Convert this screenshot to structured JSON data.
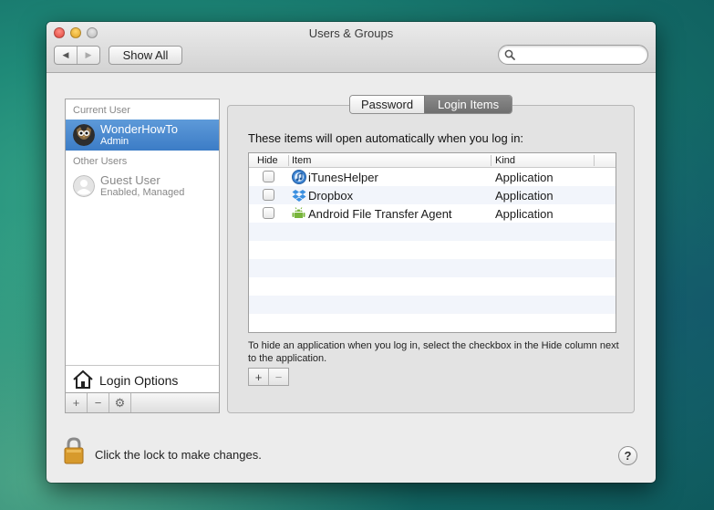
{
  "window": {
    "title": "Users & Groups"
  },
  "toolbar": {
    "back_glyph": "◀",
    "forward_glyph": "▶",
    "show_all_label": "Show All",
    "search_value": ""
  },
  "sidebar": {
    "current_user_heading": "Current User",
    "current_user": {
      "name": "WonderHowTo",
      "role": "Admin",
      "icon": "owl-avatar-icon"
    },
    "other_users_heading": "Other Users",
    "other_users": [
      {
        "name": "Guest User",
        "role": "Enabled, Managed",
        "icon": "guest-avatar-icon"
      }
    ],
    "login_options_label": "Login Options",
    "tools": {
      "add": "+",
      "remove": "−",
      "action": "⚙"
    }
  },
  "tabs": [
    {
      "label": "Password",
      "selected": false
    },
    {
      "label": "Login Items",
      "selected": true
    }
  ],
  "login_items": {
    "intro": "These items will open automatically when you log in:",
    "columns": {
      "hide": "Hide",
      "item": "Item",
      "kind": "Kind"
    },
    "rows": [
      {
        "name": "iTunesHelper",
        "kind": "Application",
        "hidden": false,
        "icon": "itunes-icon"
      },
      {
        "name": "Dropbox",
        "kind": "Application",
        "hidden": false,
        "icon": "dropbox-icon"
      },
      {
        "name": "Android File Transfer Agent",
        "kind": "Application",
        "hidden": false,
        "icon": "android-icon"
      }
    ],
    "hint": "To hide an application when you log in, select the checkbox in the Hide column next to the application.",
    "add": "+",
    "remove": "−"
  },
  "footer": {
    "lock_text": "Click the lock to make changes.",
    "help": "?"
  },
  "colors": {
    "selection": "#4a88cf",
    "tab_selected": "#7b7b7b",
    "window_bg": "#ececec"
  }
}
